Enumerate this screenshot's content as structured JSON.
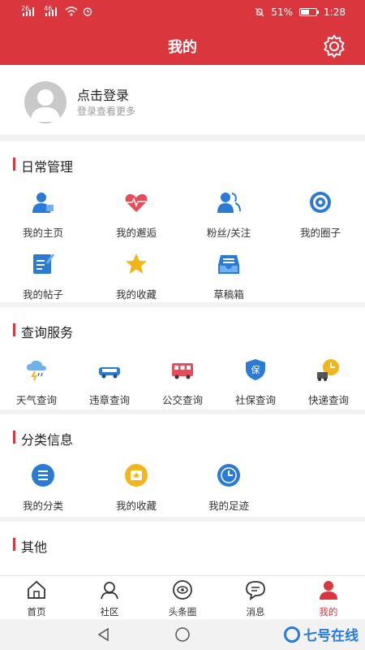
{
  "status_bar": {
    "net1": "26",
    "net2": "46",
    "battery": "51%",
    "time": "1:28"
  },
  "header": {
    "title": "我的"
  },
  "login": {
    "title": "点击登录",
    "subtitle": "登录查看更多"
  },
  "sections": [
    {
      "title": "日常管理",
      "items": [
        "我的主页",
        "我的邂逅",
        "粉丝/关注",
        "我的圈子",
        "我的帖子",
        "我的收藏",
        "草稿箱"
      ]
    },
    {
      "title": "查询服务",
      "items": [
        "天气查询",
        "违章查询",
        "公交查询",
        "社保查询",
        "快递查询"
      ]
    },
    {
      "title": "分类信息",
      "items": [
        "我的分类",
        "我的收藏",
        "我的足迹"
      ]
    },
    {
      "title": "其他",
      "items": []
    }
  ],
  "tabs": [
    {
      "label": "首页",
      "icon": "home-icon"
    },
    {
      "label": "社区",
      "icon": "community-icon"
    },
    {
      "label": "头条圈",
      "icon": "headline-icon"
    },
    {
      "label": "消息",
      "icon": "message-icon"
    },
    {
      "label": "我的",
      "icon": "user-icon",
      "active": true
    }
  ],
  "watermark": "七号在线",
  "colors": {
    "brand": "#d9363e",
    "blue": "#2a7ad6",
    "yellow": "#f2b51c"
  }
}
